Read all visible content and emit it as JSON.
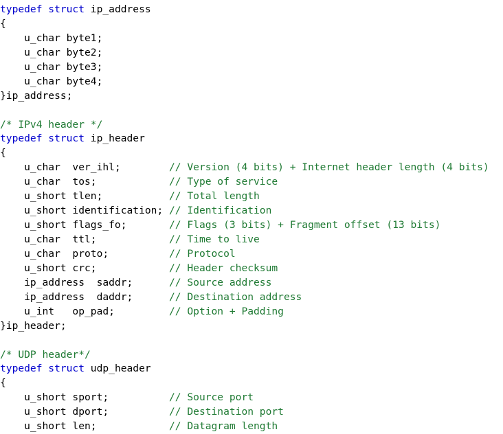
{
  "editor": {
    "background_color": "#ffffff",
    "default_text_color": "#000000",
    "keyword_color": "#0000cd",
    "comment_color": "#1f7a33",
    "language": "C"
  },
  "code": {
    "lines": [
      {
        "id": "line-1",
        "blank": false,
        "spans": [
          {
            "kind": "keyword",
            "text": "typedef struct"
          },
          {
            "kind": "plain",
            "text": " ip_address"
          }
        ]
      },
      {
        "id": "line-2",
        "blank": false,
        "spans": [
          {
            "kind": "plain",
            "text": "{"
          }
        ]
      },
      {
        "id": "line-3",
        "blank": false,
        "spans": [
          {
            "kind": "plain",
            "text": "    u_char byte1;"
          }
        ]
      },
      {
        "id": "line-4",
        "blank": false,
        "spans": [
          {
            "kind": "plain",
            "text": "    u_char byte2;"
          }
        ]
      },
      {
        "id": "line-5",
        "blank": false,
        "spans": [
          {
            "kind": "plain",
            "text": "    u_char byte3;"
          }
        ]
      },
      {
        "id": "line-6",
        "blank": false,
        "spans": [
          {
            "kind": "plain",
            "text": "    u_char byte4;"
          }
        ]
      },
      {
        "id": "line-7",
        "blank": false,
        "spans": [
          {
            "kind": "plain",
            "text": "}ip_address;"
          }
        ]
      },
      {
        "id": "line-8",
        "blank": true,
        "spans": []
      },
      {
        "id": "line-9",
        "blank": false,
        "spans": [
          {
            "kind": "comment",
            "text": "/* IPv4 header */"
          }
        ]
      },
      {
        "id": "line-10",
        "blank": false,
        "spans": [
          {
            "kind": "keyword",
            "text": "typedef struct"
          },
          {
            "kind": "plain",
            "text": " ip_header"
          }
        ]
      },
      {
        "id": "line-11",
        "blank": false,
        "spans": [
          {
            "kind": "plain",
            "text": "{"
          }
        ]
      },
      {
        "id": "line-12",
        "blank": false,
        "spans": [
          {
            "kind": "plain",
            "text": "    u_char  ver_ihl;        "
          },
          {
            "kind": "comment",
            "text": "// Version (4 bits) + Internet header length (4 bits)"
          }
        ]
      },
      {
        "id": "line-13",
        "blank": false,
        "spans": [
          {
            "kind": "plain",
            "text": "    u_char  tos;            "
          },
          {
            "kind": "comment",
            "text": "// Type of service"
          }
        ]
      },
      {
        "id": "line-14",
        "blank": false,
        "spans": [
          {
            "kind": "plain",
            "text": "    u_short tlen;           "
          },
          {
            "kind": "comment",
            "text": "// Total length"
          }
        ]
      },
      {
        "id": "line-15",
        "blank": false,
        "spans": [
          {
            "kind": "plain",
            "text": "    u_short identification; "
          },
          {
            "kind": "comment",
            "text": "// Identification"
          }
        ]
      },
      {
        "id": "line-16",
        "blank": false,
        "spans": [
          {
            "kind": "plain",
            "text": "    u_short flags_fo;       "
          },
          {
            "kind": "comment",
            "text": "// Flags (3 bits) + Fragment offset (13 bits)"
          }
        ]
      },
      {
        "id": "line-17",
        "blank": false,
        "spans": [
          {
            "kind": "plain",
            "text": "    u_char  ttl;            "
          },
          {
            "kind": "comment",
            "text": "// Time to live"
          }
        ]
      },
      {
        "id": "line-18",
        "blank": false,
        "spans": [
          {
            "kind": "plain",
            "text": "    u_char  proto;          "
          },
          {
            "kind": "comment",
            "text": "// Protocol"
          }
        ]
      },
      {
        "id": "line-19",
        "blank": false,
        "spans": [
          {
            "kind": "plain",
            "text": "    u_short crc;            "
          },
          {
            "kind": "comment",
            "text": "// Header checksum"
          }
        ]
      },
      {
        "id": "line-20",
        "blank": false,
        "spans": [
          {
            "kind": "plain",
            "text": "    ip_address  saddr;      "
          },
          {
            "kind": "comment",
            "text": "// Source address"
          }
        ]
      },
      {
        "id": "line-21",
        "blank": false,
        "spans": [
          {
            "kind": "plain",
            "text": "    ip_address  daddr;      "
          },
          {
            "kind": "comment",
            "text": "// Destination address"
          }
        ]
      },
      {
        "id": "line-22",
        "blank": false,
        "spans": [
          {
            "kind": "plain",
            "text": "    u_int   op_pad;         "
          },
          {
            "kind": "comment",
            "text": "// Option + Padding"
          }
        ]
      },
      {
        "id": "line-23",
        "blank": false,
        "spans": [
          {
            "kind": "plain",
            "text": "}ip_header;"
          }
        ]
      },
      {
        "id": "line-24",
        "blank": true,
        "spans": []
      },
      {
        "id": "line-25",
        "blank": false,
        "spans": [
          {
            "kind": "comment",
            "text": "/* UDP header*/"
          }
        ]
      },
      {
        "id": "line-26",
        "blank": false,
        "spans": [
          {
            "kind": "keyword",
            "text": "typedef struct"
          },
          {
            "kind": "plain",
            "text": " udp_header"
          }
        ]
      },
      {
        "id": "line-27",
        "blank": false,
        "spans": [
          {
            "kind": "plain",
            "text": "{"
          }
        ]
      },
      {
        "id": "line-28",
        "blank": false,
        "spans": [
          {
            "kind": "plain",
            "text": "    u_short sport;          "
          },
          {
            "kind": "comment",
            "text": "// Source port"
          }
        ]
      },
      {
        "id": "line-29",
        "blank": false,
        "spans": [
          {
            "kind": "plain",
            "text": "    u_short dport;          "
          },
          {
            "kind": "comment",
            "text": "// Destination port"
          }
        ]
      },
      {
        "id": "line-30",
        "blank": false,
        "spans": [
          {
            "kind": "plain",
            "text": "    u_short len;            "
          },
          {
            "kind": "comment",
            "text": "// Datagram length"
          }
        ]
      }
    ]
  }
}
